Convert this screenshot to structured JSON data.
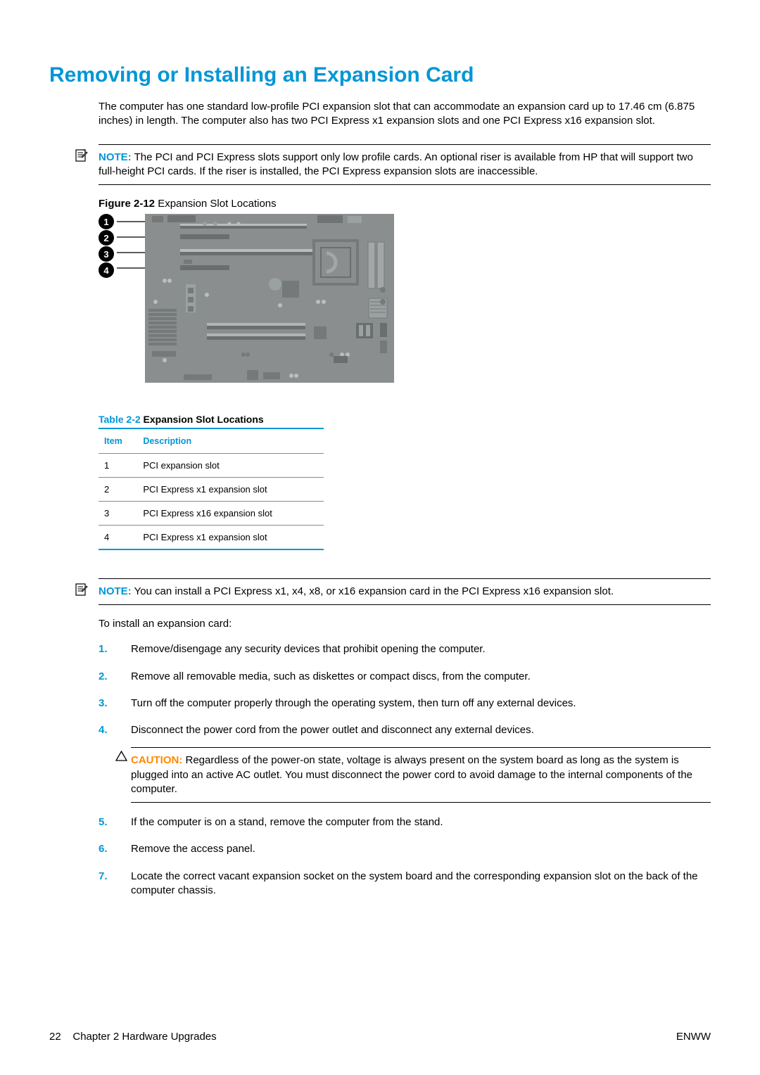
{
  "title": "Removing or Installing an Expansion Card",
  "intro": "The computer has one standard low-profile PCI expansion slot that can accommodate an expansion card up to 17.46 cm (6.875 inches) in length. The computer also has two PCI Express x1 expansion slots and one PCI Express x16 expansion slot.",
  "note1_label": "NOTE:",
  "note1_text": "The PCI and PCI Express slots support only low profile cards. An optional riser is available from HP that will support two full-height PCI cards. If the riser is installed, the PCI Express expansion slots are inaccessible.",
  "figure_label": "Figure 2-12",
  "figure_title": "Expansion Slot Locations",
  "callouts": [
    "1",
    "2",
    "3",
    "4"
  ],
  "table_label": "Table 2-2",
  "table_title": "Expansion Slot Locations",
  "table_headers": {
    "item": "Item",
    "desc": "Description"
  },
  "table_rows": [
    {
      "item": "1",
      "desc": "PCI expansion slot"
    },
    {
      "item": "2",
      "desc": "PCI Express x1 expansion slot"
    },
    {
      "item": "3",
      "desc": "PCI Express x16 expansion slot"
    },
    {
      "item": "4",
      "desc": "PCI Express x1 expansion slot"
    }
  ],
  "note2_label": "NOTE:",
  "note2_text": "You can install a PCI Express x1, x4, x8, or x16 expansion card in the PCI Express x16 expansion slot.",
  "pre_list": "To install an expansion card:",
  "steps": [
    "Remove/disengage any security devices that prohibit opening the computer.",
    "Remove all removable media, such as diskettes or compact discs, from the computer.",
    "Turn off the computer properly through the operating system, then turn off any external devices.",
    "Disconnect the power cord from the power outlet and disconnect any external devices.",
    "If the computer is on a stand, remove the computer from the stand.",
    "Remove the access panel.",
    "Locate the correct vacant expansion socket on the system board and the corresponding expansion slot on the back of the computer chassis."
  ],
  "caution_label": "CAUTION:",
  "caution_text": "Regardless of the power-on state, voltage is always present on the system board as long as the system is plugged into an active AC outlet. You must disconnect the power cord to avoid damage to the internal components of the computer.",
  "footer_page": "22",
  "footer_chapter": "Chapter 2   Hardware Upgrades",
  "footer_right": "ENWW"
}
